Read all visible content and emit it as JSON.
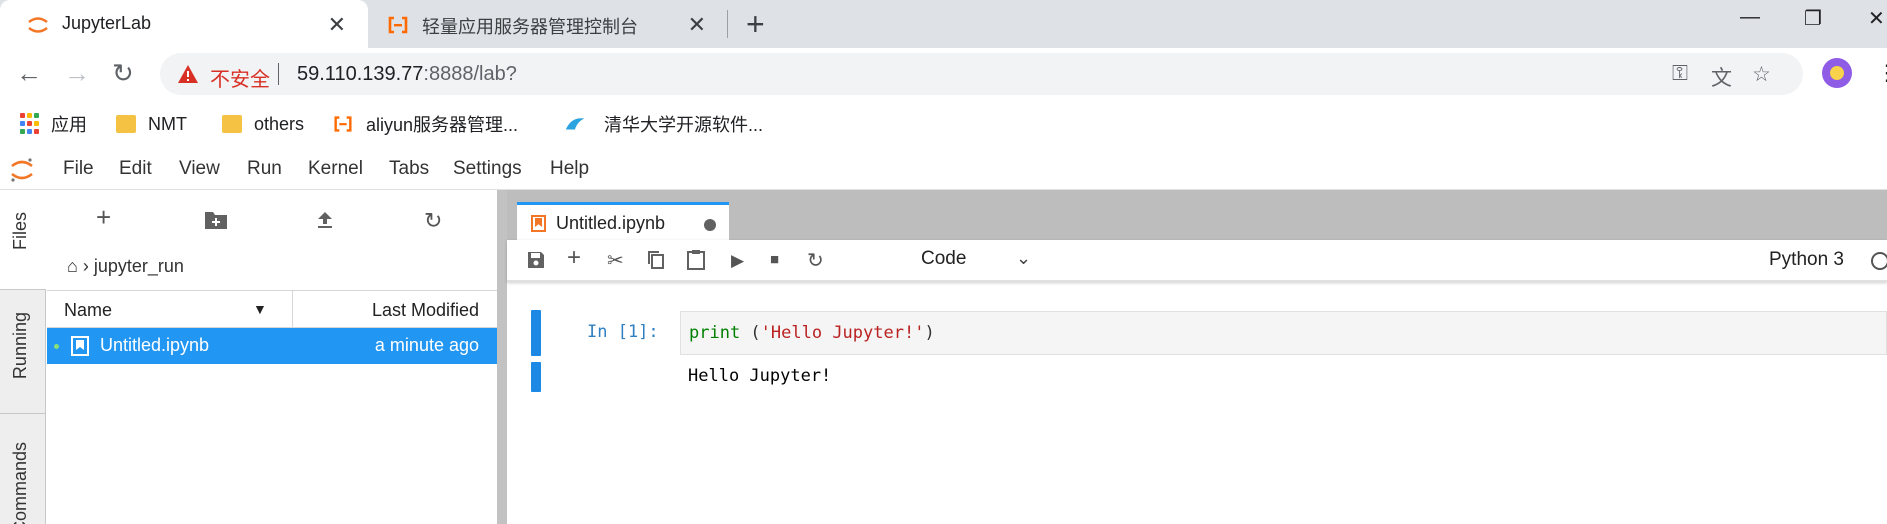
{
  "browser": {
    "tabs": [
      {
        "title": "JupyterLab",
        "active": true
      },
      {
        "title": "轻量应用服务器管理控制台",
        "active": false
      }
    ],
    "close_glyph": "✕",
    "new_tab_glyph": "+",
    "window_controls": [
      "—",
      "❐",
      "✕"
    ],
    "security_label": "不安全",
    "url_host": "59.110.139.77",
    "url_rest": ":8888/lab?",
    "bookmarks": [
      {
        "label": "应用",
        "icon": "apps-grid-icon"
      },
      {
        "label": "NMT",
        "icon": "folder-icon"
      },
      {
        "label": "others",
        "icon": "folder-icon"
      },
      {
        "label": "aliyun服务器管理...",
        "icon": "aliyun-icon"
      },
      {
        "label": "清华大学开源软件...",
        "icon": "tsinghua-icon"
      }
    ],
    "colors": {
      "tabstrip": "#dee1e6",
      "warning": "#d93025",
      "aliyun": "#ff6a00"
    }
  },
  "jupyter": {
    "menu": [
      "File",
      "Edit",
      "View",
      "Run",
      "Kernel",
      "Tabs",
      "Settings",
      "Help"
    ],
    "sidebar_tabs": [
      "Files",
      "Running",
      "Commands"
    ],
    "filebrowser": {
      "path": "jupyter_run",
      "columns": {
        "name": "Name",
        "modified": "Last Modified"
      },
      "files": [
        {
          "name": "Untitled.ipynb",
          "modified": "a minute ago",
          "selected": true,
          "running": true
        }
      ]
    },
    "notebook": {
      "tab_label": "Untitled.ipynb",
      "cell_type": "Code",
      "kernel": "Python 3",
      "cells": [
        {
          "prompt": "In [1]:",
          "code_fn": "print",
          "code_open": " (",
          "code_str": "'Hello Jupyter!'",
          "code_close": ")",
          "output": "Hello Jupyter!"
        }
      ]
    },
    "colors": {
      "accent": "#2196f3",
      "brand": "#f37626",
      "prompt": "#307fc1"
    }
  }
}
